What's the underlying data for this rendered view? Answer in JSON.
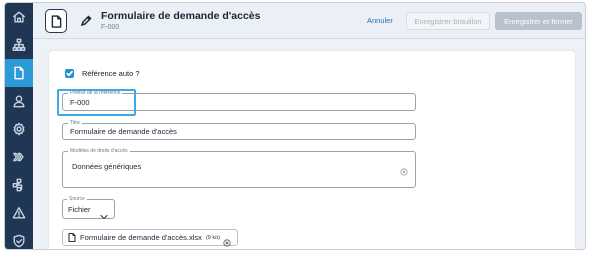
{
  "header": {
    "title": "Formulaire de demande d'accès",
    "code": "F-000",
    "cancel_label": "Annuler",
    "save_draft_label": "Enregistrer brouillon",
    "save_close_label": "Enregistrer et fermer"
  },
  "sidebar": {
    "items": [
      {
        "icon": "home-icon"
      },
      {
        "icon": "hierarchy-icon"
      },
      {
        "icon": "document-icon",
        "active": true
      },
      {
        "icon": "user-icon"
      },
      {
        "icon": "gear-icon"
      },
      {
        "icon": "chevrons-right-icon"
      },
      {
        "icon": "workflow-icon"
      },
      {
        "icon": "warning-icon"
      },
      {
        "icon": "shield-icon"
      }
    ]
  },
  "form": {
    "auto_ref": {
      "label": "Référence auto ?",
      "checked": true
    },
    "prefix": {
      "label": "Préfixe de la référence",
      "value": "F-000"
    },
    "title": {
      "label": "Titre",
      "value": "Formulaire de demande d'accès"
    },
    "models": {
      "label": "Modèles de droits d'accès",
      "value": "Données génériques"
    },
    "source": {
      "label": "Source",
      "value": "Fichier"
    },
    "file": {
      "name": "Formulaire de demande d'accès.xlsx",
      "size": "(9 ko)"
    }
  },
  "colors": {
    "sidebar": "#1f3654",
    "active": "#2b9ad6",
    "checkbox": "#2b8fd3",
    "highlight": "#3fa9e6"
  }
}
